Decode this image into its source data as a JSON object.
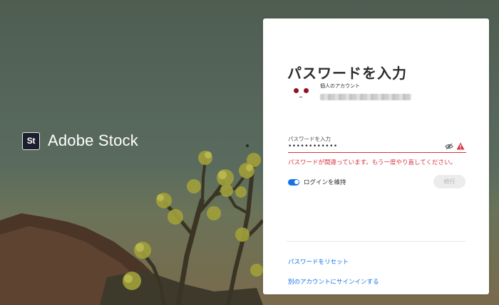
{
  "brand": {
    "logo_text": "St",
    "name": "Adobe Stock"
  },
  "card": {
    "title": "パスワードを入力",
    "account_type": "個人のアカウント",
    "password_label": "パスワードを入力",
    "password_value": "••••••••••••",
    "error_message": "パスワードが間違っています。もう一度やり直してください。",
    "stay_signed_in_label": "ログインを維持",
    "stay_signed_in": true,
    "continue_label": "続行",
    "reset_password_link": "パスワードをリセット",
    "other_account_link": "別のアカウントにサインインする"
  },
  "colors": {
    "accent": "#1473e6",
    "error": "#d7373f",
    "title_text": "#2c2c2c"
  },
  "icons": {
    "visibility_toggle": "eye-off-icon",
    "warning": "alert-triangle-icon"
  }
}
